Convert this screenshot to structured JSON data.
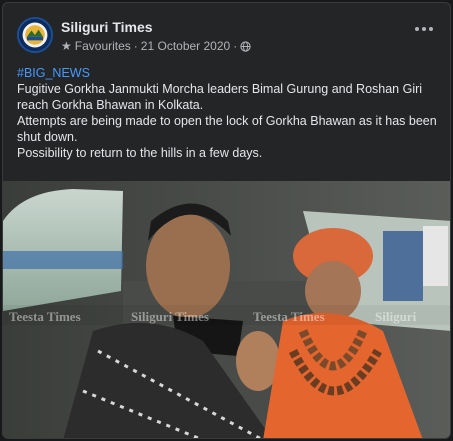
{
  "post": {
    "page_name": "Siliguri Times",
    "audience_label": "Favourites",
    "date": "21 October 2020",
    "separator": "·",
    "hashtag": "#BIG_NEWS",
    "paragraphs": [
      "Fugitive Gorkha Janmukti Morcha leaders Bimal Gurung and Roshan Giri reach Gorkha Bhawan in Kolkata.",
      "Attempts are being made to open the lock of Gorkha Bhawan as it has been shut down.",
      "Possibility to return to the hills in a few days."
    ]
  },
  "watermarks": [
    "Teesta Times",
    "Siliguri Times",
    "Teesta Times",
    "Siliguri"
  ],
  "icons": {
    "favourites": "star-icon",
    "privacy": "globe-icon",
    "more": "more-options-icon"
  },
  "colors": {
    "background": "#18191a",
    "card": "#242526",
    "text": "#e4e6eb",
    "muted": "#b0b3b8",
    "hashtag": "#4599ff"
  }
}
